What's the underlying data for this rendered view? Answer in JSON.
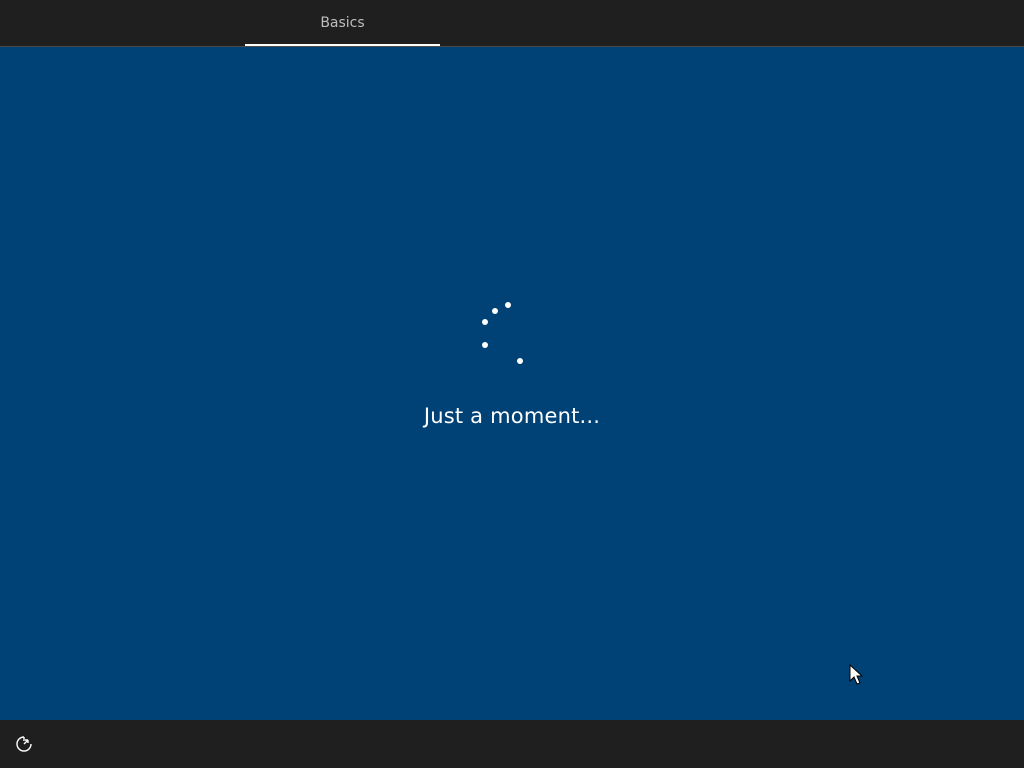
{
  "header": {
    "tabs": [
      {
        "label": "Basics",
        "active": true
      }
    ]
  },
  "main": {
    "status_text": "Just a moment..."
  },
  "footer": {
    "ease_of_access_icon": "ease-of-access-icon"
  },
  "colors": {
    "background": "#004275",
    "bars": "#1f1f1f",
    "text": "#ffffff"
  }
}
